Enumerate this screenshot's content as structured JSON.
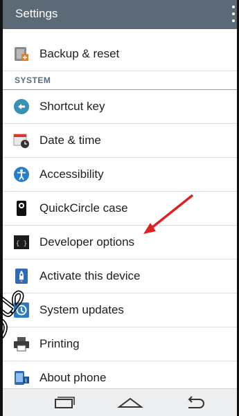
{
  "header": {
    "title": "Settings"
  },
  "list": {
    "backup_reset": "Backup & reset",
    "section_system": "SYSTEM",
    "shortcut_key": "Shortcut key",
    "date_time": "Date & time",
    "accessibility": "Accessibility",
    "quickcircle_case": "QuickCircle case",
    "developer_options": "Developer options",
    "activate_device": "Activate this device",
    "system_updates": "System updates",
    "printing": "Printing",
    "about_phone": "About phone"
  },
  "icons": {
    "backup": "backup-reset-icon",
    "shortcut": "shortcut-key-icon",
    "date": "calendar-clock-icon",
    "accessibility": "accessibility-icon",
    "quickcircle": "quickcircle-case-icon",
    "developer": "developer-code-icon",
    "activate": "rocket-icon",
    "updates": "system-update-icon",
    "printing": "printer-icon",
    "about": "phone-info-icon"
  },
  "watermark": {
    "text": "طارق داچیل"
  },
  "colors": {
    "header": "#5b6a76",
    "accent_arrow": "#e02020",
    "section_text": "#5b6b78"
  }
}
